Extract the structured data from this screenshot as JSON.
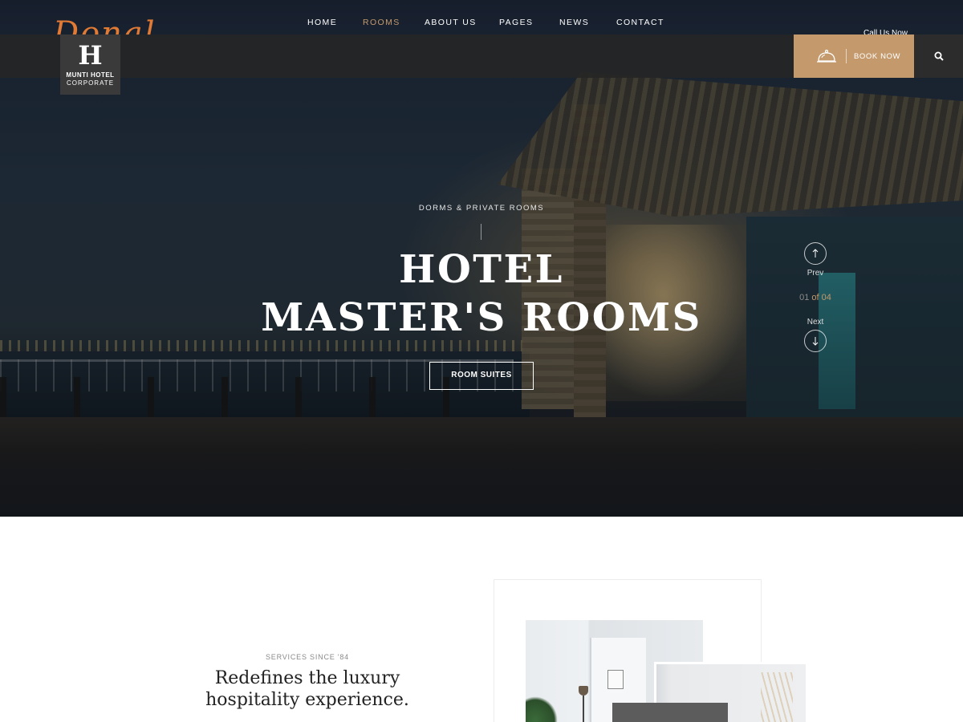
{
  "header": {
    "script_logo": "Donal",
    "call_us": "Call Us Now",
    "logo": {
      "letter": "H",
      "name": "MUNTI HOTEL",
      "subtitle": "CORPORATE"
    },
    "nav": [
      {
        "label": "HOME",
        "active": false
      },
      {
        "label": "ROOMS",
        "active": true
      },
      {
        "label": "ABOUT US",
        "active": false
      },
      {
        "label": "PAGES",
        "active": false
      },
      {
        "label": "NEWS",
        "active": false
      },
      {
        "label": "CONTACT",
        "active": false
      }
    ],
    "book_now": {
      "label": "BOOK NOW",
      "icon": "bell-icon"
    },
    "search": {
      "icon": "search-icon"
    }
  },
  "hero": {
    "eyebrow": "DORMS & PRIVATE ROOMS",
    "title_line1": "HOTEL",
    "title_line2": "MASTER'S ROOMS",
    "button": "ROOM SUITES",
    "slider": {
      "prev_label": "Prev",
      "next_label": "Next",
      "current": "01",
      "of_text": " of ",
      "total": "04"
    }
  },
  "services": {
    "eyebrow": "SERVICES SINCE '84",
    "title_line1": "Redefines the luxury",
    "title_line2": "hospitality experience."
  },
  "colors": {
    "accent": "#c49a6c",
    "navbar": "#262626",
    "logo_box": "#3a3a3a",
    "script_logo": "#e07a35"
  }
}
